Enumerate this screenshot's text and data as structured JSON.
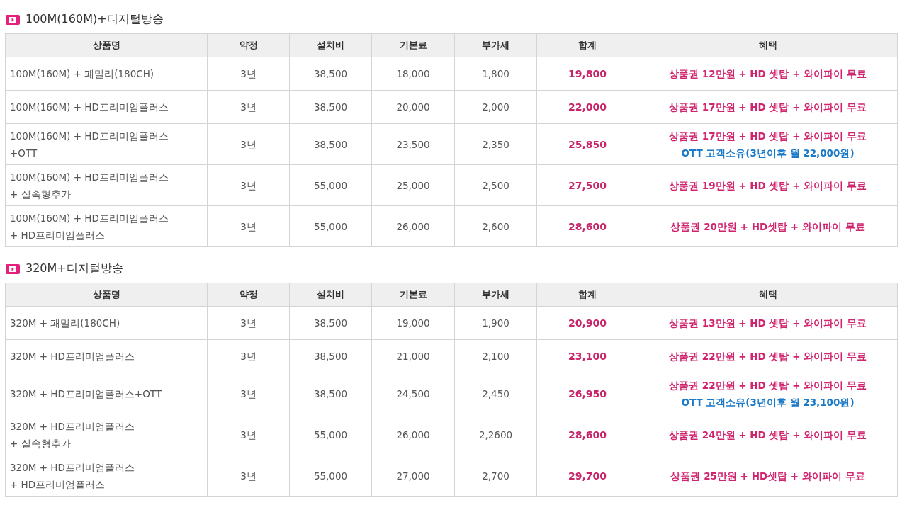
{
  "sections": [
    {
      "title": "100M(160M)+디지털방송",
      "columns": [
        "상품명",
        "약정",
        "설치비",
        "기본료",
        "부가세",
        "합계",
        "혜택"
      ],
      "rows": [
        {
          "product": [
            "100M(160M) + 패밀리(180CH)"
          ],
          "term": "3년",
          "install": "38,500",
          "base": "18,000",
          "vat": "1,800",
          "total": "19,800",
          "benefits": [
            {
              "kind": "gift",
              "text": "상품권 12만원 + HD 셋탑 + 와이파이 무료"
            }
          ]
        },
        {
          "product": [
            "100M(160M) + HD프리미엄플러스"
          ],
          "term": "3년",
          "install": "38,500",
          "base": "20,000",
          "vat": "2,000",
          "total": "22,000",
          "benefits": [
            {
              "kind": "gift",
              "text": "상품권 17만원 + HD 셋탑 + 와이파이 무료"
            }
          ]
        },
        {
          "product": [
            "100M(160M) + HD프리미엄플러스",
            "+OTT"
          ],
          "term": "3년",
          "install": "38,500",
          "base": "23,500",
          "vat": "2,350",
          "total": "25,850",
          "benefits": [
            {
              "kind": "gift",
              "text": "상품권 17만원 + HD 셋탑 + 와이파이 무료"
            },
            {
              "kind": "ott",
              "text": "OTT 고객소유(3년이후 월 22,000원)"
            }
          ]
        },
        {
          "product": [
            "100M(160M) + HD프리미엄플러스",
            "+ 실속형추가"
          ],
          "term": "3년",
          "install": "55,000",
          "base": "25,000",
          "vat": "2,500",
          "total": "27,500",
          "benefits": [
            {
              "kind": "gift",
              "text": "상품권 19만원 + HD 셋탑 + 와이파이 무료"
            }
          ]
        },
        {
          "product": [
            "100M(160M) + HD프리미엄플러스",
            "+ HD프리미엄플러스"
          ],
          "term": "3년",
          "install": "55,000",
          "base": "26,000",
          "vat": "2,600",
          "total": "28,600",
          "benefits": [
            {
              "kind": "gift",
              "text": "상품권 20만원 + HD셋탑 + 와이파이 무료"
            }
          ]
        }
      ]
    },
    {
      "title": "320M+디지털방송",
      "columns": [
        "상품명",
        "약정",
        "설치비",
        "기본료",
        "부가세",
        "합계",
        "혜택"
      ],
      "rows": [
        {
          "product": [
            "320M + 패밀리(180CH)"
          ],
          "term": "3년",
          "install": "38,500",
          "base": "19,000",
          "vat": "1,900",
          "total": "20,900",
          "benefits": [
            {
              "kind": "gift",
              "text": "상품권 13만원 + HD 셋탑 + 와이파이 무료"
            }
          ]
        },
        {
          "product": [
            "320M + HD프리미엄플러스"
          ],
          "term": "3년",
          "install": "38,500",
          "base": "21,000",
          "vat": "2,100",
          "total": "23,100",
          "benefits": [
            {
              "kind": "gift",
              "text": "상품권 22만원 + HD 셋탑 + 와이파이 무료"
            }
          ]
        },
        {
          "product": [
            "320M + HD프리미엄플러스+OTT"
          ],
          "term": "3년",
          "install": "38,500",
          "base": "24,500",
          "vat": "2,450",
          "total": "26,950",
          "benefits": [
            {
              "kind": "gift",
              "text": "상품권 22만원 + HD 셋탑 + 와이파이 무료"
            },
            {
              "kind": "ott",
              "text": "OTT 고객소유(3년이후 월 23,100원)"
            }
          ]
        },
        {
          "product": [
            "320M + HD프리미엄플러스",
            "+ 실속형추가"
          ],
          "term": "3년",
          "install": "55,000",
          "base": "26,000",
          "vat": "2,2600",
          "total": "28,600",
          "benefits": [
            {
              "kind": "gift",
              "text": "상품권 24만원 + HD 셋탑 + 와이파이 무료"
            }
          ]
        },
        {
          "product": [
            "320M + HD프리미엄플러스",
            "+ HD프리미엄플러스"
          ],
          "term": "3년",
          "install": "55,000",
          "base": "27,000",
          "vat": "2,700",
          "total": "29,700",
          "benefits": [
            {
              "kind": "gift",
              "text": "상품권 25만원 + HD셋탑 + 와이파이 무료"
            }
          ]
        }
      ]
    }
  ]
}
